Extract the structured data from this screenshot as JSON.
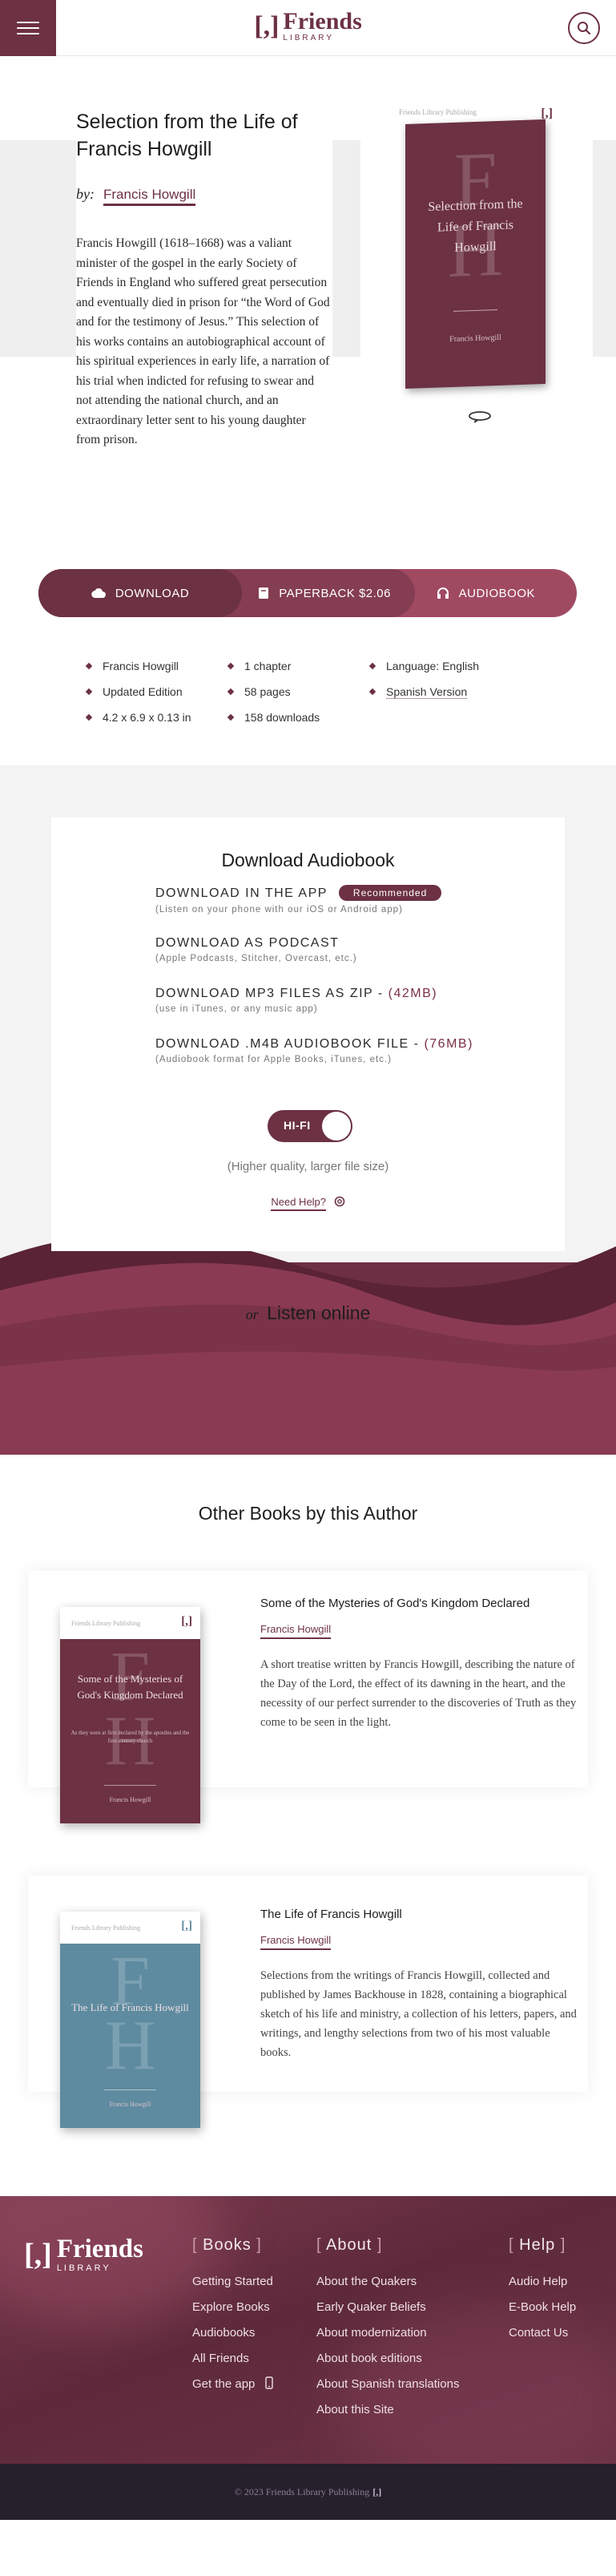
{
  "header": {
    "logo_mark": "[,]",
    "logo_word": "Friends",
    "logo_sub": "LIBRARY"
  },
  "book": {
    "title": "Selection from the Life of Francis Howgill",
    "by": "by:",
    "author": "Francis Howgill",
    "description": "Francis Howgill (1618–1668) was a valiant minister of the gospel in the early Society of Friends in England who suffered great persecution and eventually died in prison for “the Word of God and for the testimony of Jesus.” This selection of his works contains an autobiographical account of his spiritual experiences in early life, a narration of his trial when indicted for refusing to swear and not attending the national church, and an extraordinary letter sent to his young daughter from prison.",
    "cover": {
      "publisher": "Friends Library Publishing",
      "mark": "[,]",
      "initials_top": "F",
      "initials_bottom": "H",
      "title": "Selection from the Life of Francis Howgill",
      "author": "Francis Howgill",
      "color": "#6c3142"
    }
  },
  "actions": {
    "download": "DOWNLOAD",
    "paperback": "PAPERBACK $2.06",
    "audiobook": "AUDIOBOOK"
  },
  "meta": {
    "col1": [
      "Francis Howgill",
      "Updated Edition",
      "4.2 x 6.9 x 0.13 in"
    ],
    "col2": [
      "1 chapter",
      "58 pages",
      "158 downloads"
    ],
    "col3": [
      "Language: English",
      "Spanish Version"
    ]
  },
  "audio_download": {
    "title": "Download Audiobook",
    "options": [
      {
        "label": "DOWNLOAD IN THE APP",
        "size": "",
        "badge": "Recommended",
        "sub": "(Listen on your phone with our iOS or Android app)"
      },
      {
        "label": "DOWNLOAD AS PODCAST",
        "size": "",
        "badge": "",
        "sub": "(Apple Podcasts, Stitcher, Overcast, etc.)"
      },
      {
        "label": "DOWNLOAD MP3 FILES AS ZIP - ",
        "size": "(42MB)",
        "badge": "",
        "sub": "(use in iTunes, or any music app)"
      },
      {
        "label": "DOWNLOAD .M4B AUDIOBOOK FILE - ",
        "size": "(76MB)",
        "badge": "",
        "sub": "(Audiobook format for Apple Books, iTunes, etc.)"
      }
    ],
    "toggle_label": "HI-FI",
    "quality_note": "(Higher quality, larger file size)",
    "help": "Need Help?",
    "listen_or": "or",
    "listen_online": "Listen online"
  },
  "other_books": {
    "title": "Other Books by this Author",
    "items": [
      {
        "title": "Some of the Mysteries of God's Kingdom Declared",
        "author": "Francis Howgill",
        "description": "A short treatise written by Francis Howgill, describing the nature of the Day of the Lord, the effect of its dawning in the heart, and the necessity of our perfect surrender to the discoveries of Truth as they come to be seen in the light.",
        "cover_title": "Some of the Mysteries of God's Kingdom Declared",
        "cover_subtitle": "As they were at first declared by the apostles and the first-century church",
        "cover_color": "#6c3142"
      },
      {
        "title": "The Life of Francis Howgill",
        "author": "Francis Howgill",
        "description": "Selections from the writings of Francis Howgill, collected and published by James Backhouse in 1828, containing a biographical sketch of his life and ministry, a collection of his letters, papers, and writings, and lengthy selections from two of his most valuable books.",
        "cover_title": "The Life of Francis Howgill",
        "cover_subtitle": "",
        "cover_color": "#5e8ba0"
      }
    ]
  },
  "footer": {
    "logo_mark": "[,]",
    "logo_word": "Friends",
    "logo_sub": "LIBRARY",
    "books": {
      "heading": "Books",
      "links": [
        "Getting Started",
        "Explore Books",
        "Audiobooks",
        "All Friends",
        "Get the app"
      ]
    },
    "about": {
      "heading": "About",
      "links": [
        "About the Quakers",
        "Early Quaker Beliefs",
        "About modernization",
        "About book editions",
        "About Spanish translations",
        "About this Site"
      ]
    },
    "help": {
      "heading": "Help",
      "links": [
        "Audio Help",
        "E-Book Help",
        "Contact Us"
      ]
    },
    "copyright": "© 2023 Friends Library Publishing",
    "copyright_mark": "[,]"
  },
  "colors": {
    "brand": "#6c3142",
    "brand_mid": "#843d51",
    "brand_light": "#a04a62",
    "footer_bottom": "#261f2c"
  }
}
